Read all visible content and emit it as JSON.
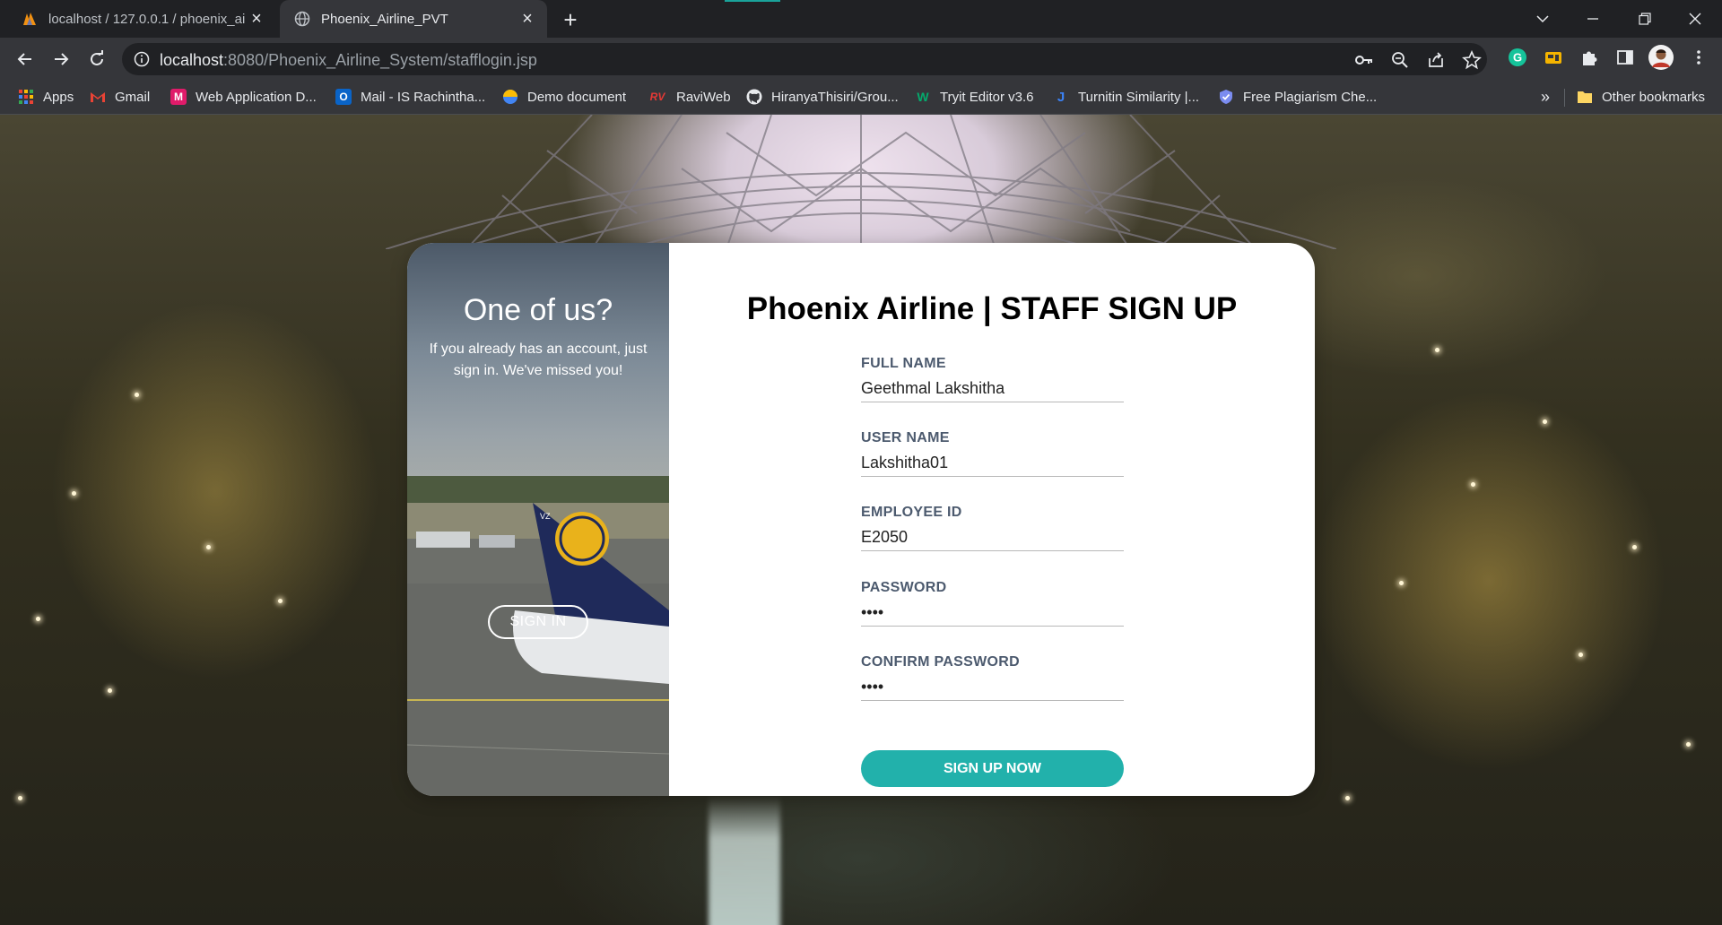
{
  "browser": {
    "tabs": [
      {
        "title": "localhost / 127.0.0.1 / phoenix_ai",
        "favicon": "phpmyadmin-icon",
        "active": false
      },
      {
        "title": "Phoenix_Airline_PVT",
        "favicon": "globe-icon",
        "active": true
      }
    ],
    "url_host": "localhost",
    "url_rest": ":8080/Phoenix_Airline_System/stafflogin.jsp",
    "bookmarks": [
      {
        "label": "Apps",
        "icon": "apps-grid-icon"
      },
      {
        "label": "Gmail",
        "icon": "gmail-icon"
      },
      {
        "label": "Web Application D...",
        "icon": "m-icon"
      },
      {
        "label": "Mail - IS Rachintha...",
        "icon": "outlook-icon"
      },
      {
        "label": "Demo document",
        "icon": "drive-icon"
      },
      {
        "label": "RaviWeb",
        "icon": "rv-icon"
      },
      {
        "label": "HiranyaThisiri/Grou...",
        "icon": "github-icon"
      },
      {
        "label": "Tryit Editor v3.6",
        "icon": "w3schools-icon"
      },
      {
        "label": "Turnitin Similarity |...",
        "icon": "turnitin-icon"
      },
      {
        "label": "Free Plagiarism Che...",
        "icon": "shield-icon"
      }
    ],
    "bookmarks_overflow": "»",
    "other_bookmarks": "Other bookmarks"
  },
  "side_panel": {
    "title": "One of us?",
    "text": "If you already has an account, just sign in. We've missed you!",
    "signin_label": "SIGN IN"
  },
  "form": {
    "title": "Phoenix Airline | STAFF SIGN UP",
    "fields": [
      {
        "label": "FULL NAME",
        "value": "Geethmal Lakshitha"
      },
      {
        "label": "USER NAME",
        "value": "Lakshitha01"
      },
      {
        "label": "EMPLOYEE ID",
        "value": "E2050"
      },
      {
        "label": "PASSWORD",
        "value": "••••"
      },
      {
        "label": "CONFIRM PASSWORD",
        "value": "••••"
      }
    ],
    "submit_label": "SIGN UP NOW"
  },
  "colors": {
    "accent": "#22b1ab",
    "label": "#4c5a6e",
    "chrome_bg": "#202124",
    "toolbar_bg": "#35363a"
  }
}
